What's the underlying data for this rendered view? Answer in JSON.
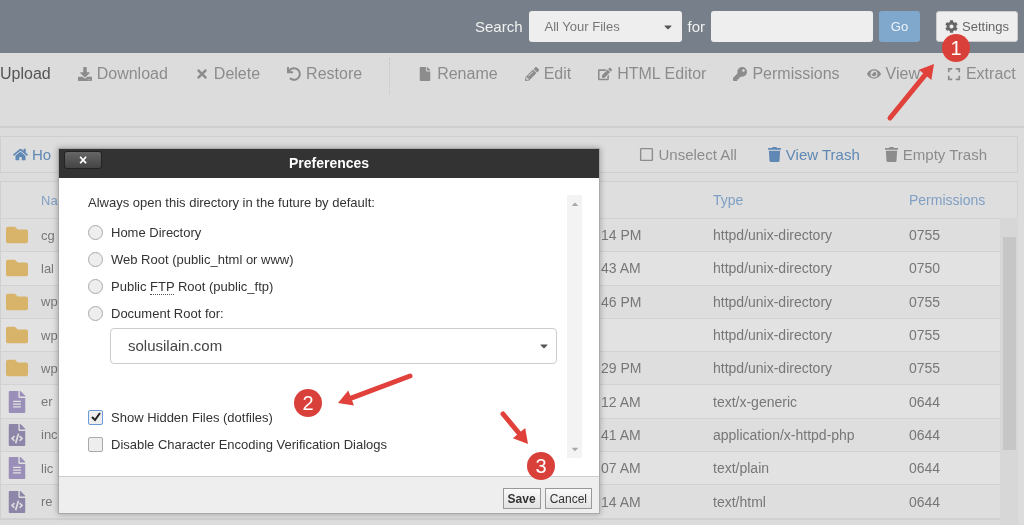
{
  "top_bar": {
    "search_label": "Search",
    "scope": "All Your Files",
    "for_label": "for",
    "go": "Go",
    "settings": "Settings"
  },
  "toolbar": [
    {
      "kind": "upload",
      "label": "Upload",
      "disabled": false
    },
    {
      "kind": "download",
      "label": "Download",
      "disabled": true
    },
    {
      "kind": "delete",
      "label": "Delete",
      "disabled": true
    },
    {
      "kind": "restore",
      "label": "Restore",
      "disabled": true
    },
    {
      "kind": "rename",
      "label": "Rename",
      "disabled": true
    },
    {
      "kind": "edit",
      "label": "Edit",
      "disabled": true
    },
    {
      "kind": "html",
      "label": "HTML Editor",
      "disabled": true
    },
    {
      "kind": "permissions",
      "label": "Permissions",
      "disabled": true
    },
    {
      "kind": "view",
      "label": "View",
      "disabled": true
    },
    {
      "kind": "extract",
      "label": "Extract",
      "disabled": true
    }
  ],
  "nav_bar": {
    "home": "Ho",
    "actions": [
      {
        "kind": "unselect",
        "label": "Unselect All",
        "disabled": true
      },
      {
        "kind": "trash",
        "label": "View Trash",
        "disabled": false
      },
      {
        "kind": "trash",
        "label": "Empty Trash",
        "disabled": true
      }
    ]
  },
  "table": {
    "columns": [
      "Na",
      "Type",
      "Permissions"
    ],
    "rows": [
      {
        "kind": "folder",
        "name": "cg",
        "modified": "14 PM",
        "type": "httpd/unix-directory",
        "permissions": "0755"
      },
      {
        "kind": "folder",
        "name": "lal",
        "modified": "43 AM",
        "type": "httpd/unix-directory",
        "permissions": "0750"
      },
      {
        "kind": "folder",
        "name": "wp",
        "modified": "46 PM",
        "type": "httpd/unix-directory",
        "permissions": "0755"
      },
      {
        "kind": "folder",
        "name": "wp",
        "type": "httpd/unix-directory",
        "permissions": "0755"
      },
      {
        "kind": "folder",
        "name": "wp",
        "modified": "29 PM",
        "type": "httpd/unix-directory",
        "permissions": "0755"
      },
      {
        "kind": "text",
        "name": "er",
        "modified": "12 AM",
        "type": "text/x-generic",
        "permissions": "0644"
      },
      {
        "kind": "code",
        "name": "inc",
        "modified": "41 AM",
        "type": "application/x-httpd-php",
        "permissions": "0644"
      },
      {
        "kind": "text",
        "name": "lic",
        "modified": "07 AM",
        "type": "text/plain",
        "permissions": "0644"
      },
      {
        "kind": "code",
        "name": "re",
        "modified": "14 AM",
        "type": "text/html",
        "permissions": "0644"
      }
    ]
  },
  "dialog": {
    "title": "Preferences",
    "close": "×",
    "intro": "Always open this directory in the future by default:",
    "radios": [
      {
        "label": "Home Directory",
        "selected": false
      },
      {
        "label": "Web Root (public_html or www)",
        "selected": false
      },
      {
        "label_before": "Public ",
        "abbr": "FTP",
        "label_after": " Root (public_ftp)",
        "selected": false
      },
      {
        "label": "Document Root for:",
        "selected": false
      }
    ],
    "domain": "solusilain.com",
    "checkboxes": [
      {
        "label": "Show Hidden Files (dotfiles)",
        "checked": true
      },
      {
        "label": "Disable Character Encoding Verification Dialogs",
        "checked": false
      }
    ],
    "buttons": [
      {
        "kind": "primary",
        "label": "Save"
      },
      {
        "kind": "secondary",
        "label": "Cancel"
      }
    ]
  },
  "annotations": [
    {
      "number": "1"
    },
    {
      "number": "2"
    },
    {
      "number": "3"
    }
  ]
}
